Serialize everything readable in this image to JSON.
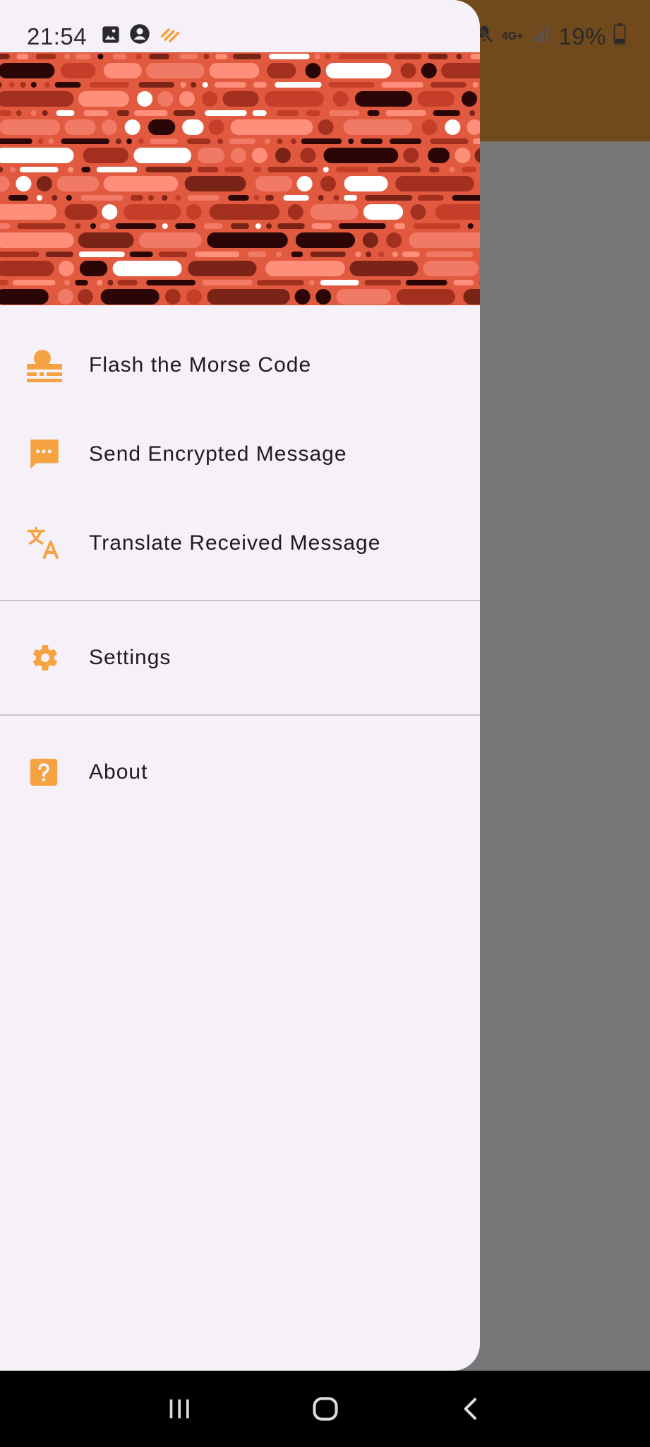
{
  "status_bar": {
    "time": "21:54",
    "battery": "19%",
    "network": "4G+"
  },
  "drawer": {
    "menu_items": [
      {
        "label": "Flash the Morse Code",
        "icon": "flash-morse-icon"
      },
      {
        "label": "Send Encrypted Message",
        "icon": "chat-bubble-icon"
      },
      {
        "label": "Translate Received Message",
        "icon": "translate-icon"
      }
    ],
    "settings": {
      "label": "Settings",
      "icon": "gear-icon"
    },
    "about": {
      "label": "About",
      "icon": "help-icon"
    }
  },
  "colors": {
    "accent": "#f5a340",
    "drawer_bg": "#f6f1f9",
    "header_bg": "#e15a3f",
    "app_bar": "#70491d",
    "scrim": "#777777"
  },
  "nav_bar": {
    "recent": "recent-apps-icon",
    "home": "home-icon",
    "back": "back-icon"
  }
}
